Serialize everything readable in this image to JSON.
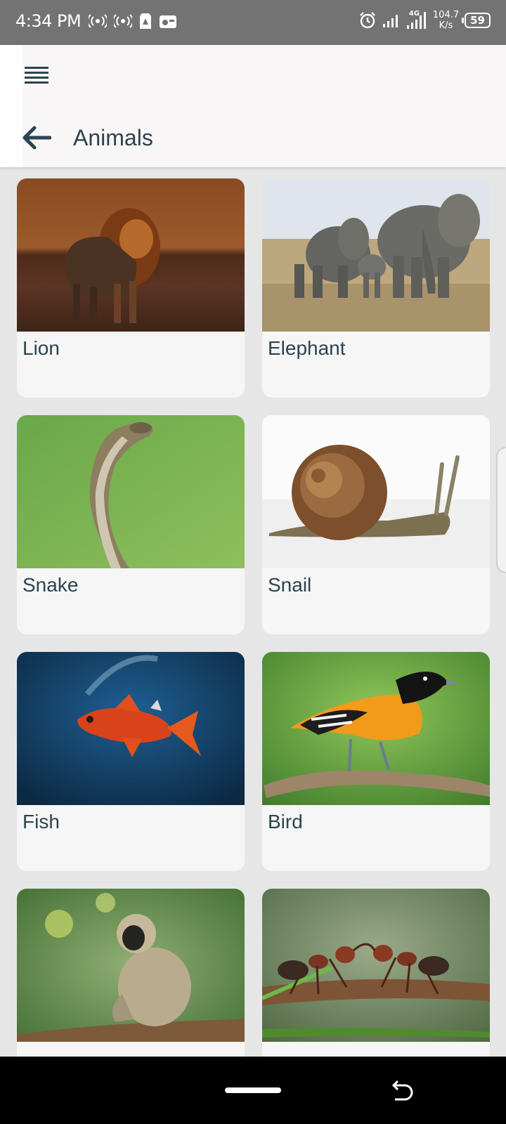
{
  "status_bar": {
    "time": "4:34 PM",
    "speed_value": "104.7",
    "speed_unit": "K/s",
    "network_type": "4G",
    "battery": "59",
    "icons": [
      "hotspot-icon",
      "hotspot-icon",
      "storage-icon",
      "radio-icon",
      "alarm-icon",
      "signal-icon",
      "signal-4g-icon"
    ]
  },
  "header": {
    "title": "Animals",
    "menu_icon": "hamburger-menu-icon",
    "back_icon": "arrow-left-icon"
  },
  "animals": [
    {
      "label": "Lion"
    },
    {
      "label": "Elephant"
    },
    {
      "label": "Snake"
    },
    {
      "label": "Snail"
    },
    {
      "label": "Fish"
    },
    {
      "label": "Bird"
    },
    {
      "label": "Monkey"
    },
    {
      "label": "Ant"
    }
  ],
  "colors": {
    "status_bar": "#737373",
    "background": "#e6e6e6",
    "card": "#f6f6f6",
    "text": "#2c4450"
  }
}
